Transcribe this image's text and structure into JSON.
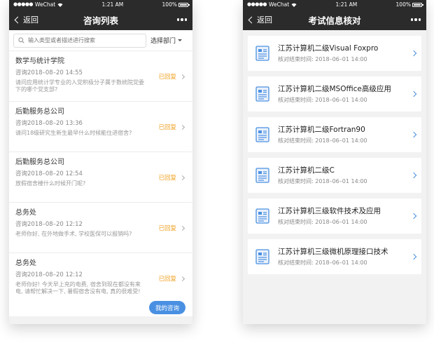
{
  "left_screen": {
    "status_bar": {
      "carrier": "WeChat",
      "time": "1:21 AM",
      "battery": "100%"
    },
    "nav": {
      "back_label": "返回",
      "title": "咨询列表"
    },
    "search": {
      "placeholder": "输入类型或者描述进行搜索"
    },
    "filter_label": "选择部门",
    "items": [
      {
        "title": "数学与统计学院",
        "date": "咨询2018–08–20  14:55",
        "desc": "请问应用统计学专业的入党积极分子属于数统院党委下的哪个党支部?",
        "status": "已回复"
      },
      {
        "title": "后勤服务总公司",
        "date": "咨询2018–08–20  13:36",
        "desc": "请问18级研究生新生最早什么时候能住进宿舍?",
        "status": "已回复"
      },
      {
        "title": "后勤服务总公司",
        "date": "咨询2018–08–20  12:54",
        "desc": "放假宿舍楼什么时候开门呢?",
        "status": "已回复"
      },
      {
        "title": "总务处",
        "date": "咨询2018–08–20  12:12",
        "desc": "老师你好, 在外地做手术, 学校医保可以报销吗?",
        "status": "已回复"
      },
      {
        "title": "总务处",
        "date": "咨询2018–08–20  12:12",
        "desc": "老师你好! 今天早上充的电费, 宿舍到现在都没有来电, 请帮忙解决一下, 暑假宿舍没有电, 真的很难受!",
        "status": "已回复"
      }
    ],
    "fab_label": "我的咨询"
  },
  "right_screen": {
    "status_bar": {
      "carrier": "WeChat",
      "time": "1:21 AM",
      "battery": "100%"
    },
    "nav": {
      "back_label": "返回",
      "title": "考试信息核对"
    },
    "cards": [
      {
        "title": "江苏计算机二级Visual   Foxpro",
        "sub": "核对结束时间:  2018–06–01  14:00"
      },
      {
        "title": "江苏计算机二级MSOffice高级应用",
        "sub": "核对结束时间:  2018–06–01  14:00"
      },
      {
        "title": "江苏计算机二级Fortran90",
        "sub": "核对结束时间:  2018–06–01  14:00"
      },
      {
        "title": "江苏计算机二级C",
        "sub": "核对结束时间:  2018–06–01  14:00"
      },
      {
        "title": "江苏计算机三级软件技术及应用",
        "sub": "核对结束时间:  2018–06–01  14:00"
      },
      {
        "title": "江苏计算机三级微机原理接口技术",
        "sub": "核对结束时间:  2018–06–01  14:00"
      }
    ]
  },
  "colors": {
    "nav_bg": "#2b2b2b",
    "status_replied": "#f0a020",
    "accent": "#4a90e2",
    "page_bg": "#f2f2f2"
  },
  "icons": {
    "back": "chevron-left-icon",
    "more": "more-dots-icon",
    "search": "search-icon",
    "filter": "caret-down-icon",
    "row": "chevron-right-icon",
    "card": "document-icon"
  }
}
